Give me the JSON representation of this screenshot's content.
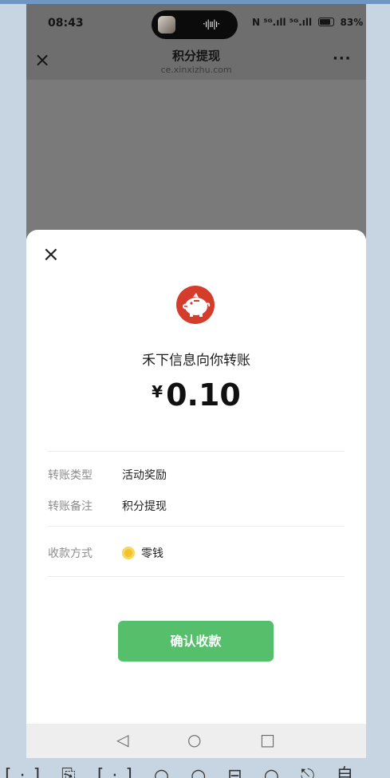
{
  "status_bar": {
    "time": "08:43",
    "island_wave": "·ı|ıı|ı·",
    "signal": "N ⁵ᴳ.ıll ⁵ᴳ.ıll",
    "battery": "83%"
  },
  "nav": {
    "close_glyph": "×",
    "title": "积分提现",
    "subtitle": "ce.xinxizhu.com",
    "more_glyph": "···"
  },
  "sheet": {
    "close_glyph": "×",
    "payer": "禾下信息向你转账",
    "currency": "¥",
    "amount": "0.10",
    "rows": [
      {
        "label": "转账类型",
        "value": "活动奖励"
      },
      {
        "label": "转账备注",
        "value": "积分提现"
      },
      {
        "label": "收款方式",
        "value": "零钱"
      }
    ],
    "confirm_label": "确认收款",
    "pig_icon": "piggy-bank-icon",
    "coin_icon": "coin-icon"
  },
  "system_nav": {
    "back": "◁",
    "home": "○",
    "recents": "□"
  },
  "bottom_strip": "[·] ⎘ [·] ○ ○ ⊟ ○ ⎋ 自",
  "colors": {
    "confirm_green": "#55bf6b",
    "pig_red": "#d43c2c",
    "coin_yellow": "#f2c230"
  }
}
